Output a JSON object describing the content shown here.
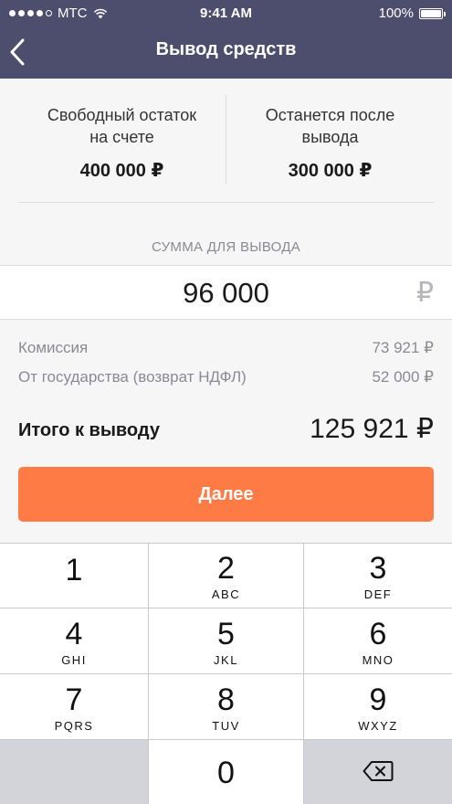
{
  "status_bar": {
    "carrier": "МТС",
    "time": "9:41 AM",
    "battery": "100%"
  },
  "nav": {
    "title": "Вывод средств",
    "back_icon": "chevron-left-icon"
  },
  "balances": {
    "available": {
      "label": "Свободный остаток\nна счете",
      "value": "400 000 ₽"
    },
    "remaining": {
      "label": "Останется после\nвывода",
      "value": "300 000 ₽"
    }
  },
  "amount": {
    "caption": "СУММА ДЛЯ ВЫВОДА",
    "value": "96 000",
    "currency": "₽"
  },
  "fees": [
    {
      "label": "Комиссия",
      "value": "73 921 ₽"
    },
    {
      "label": "От государства (возврат НДФЛ)",
      "value": "52 000 ₽"
    }
  ],
  "total": {
    "label": "Итого к выводу",
    "value": "125 921 ₽"
  },
  "next_button": {
    "label": "Далее"
  },
  "keypad": {
    "keys": [
      {
        "num": "1",
        "letters": ""
      },
      {
        "num": "2",
        "letters": "ABC"
      },
      {
        "num": "3",
        "letters": "DEF"
      },
      {
        "num": "4",
        "letters": "GHI"
      },
      {
        "num": "5",
        "letters": "JKL"
      },
      {
        "num": "6",
        "letters": "MNO"
      },
      {
        "num": "7",
        "letters": "PQRS"
      },
      {
        "num": "8",
        "letters": "TUV"
      },
      {
        "num": "9",
        "letters": "WXYZ"
      }
    ],
    "zero": "0",
    "delete_icon": "backspace-icon"
  },
  "colors": {
    "header": "#4d4d6e",
    "accent": "#ff7b45",
    "background": "#f6f6f7"
  }
}
